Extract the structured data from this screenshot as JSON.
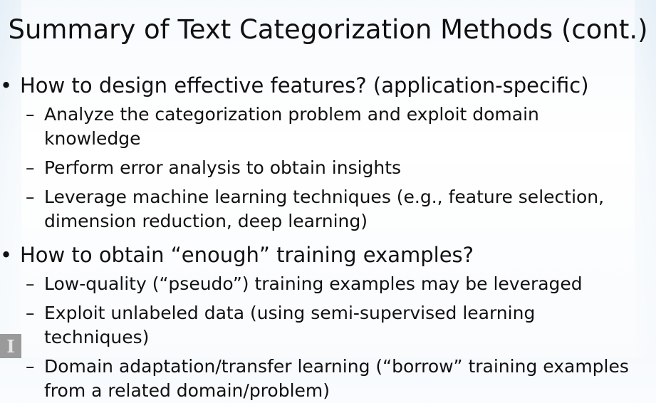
{
  "slide": {
    "title": "Summary of Text Categorization Methods (cont.)",
    "bullet_marker": "•",
    "dash_marker": "–",
    "logo_text": "I",
    "bullets": [
      {
        "text": "How to design effective features?  (application-specific)",
        "subitems": [
          "Analyze the categorization problem and exploit domain knowledge",
          "Perform error analysis to obtain insights",
          "Leverage machine learning techniques (e.g., feature selection, dimension reduction, deep learning)"
        ]
      },
      {
        "text": "How to obtain “enough” training examples?",
        "subitems": [
          "Low-quality (“pseudo”) training examples may be leveraged",
          "Exploit unlabeled data (using semi-supervised learning techniques)",
          "Domain adaptation/transfer learning (“borrow” training examples from a related domain/problem)"
        ]
      }
    ]
  }
}
